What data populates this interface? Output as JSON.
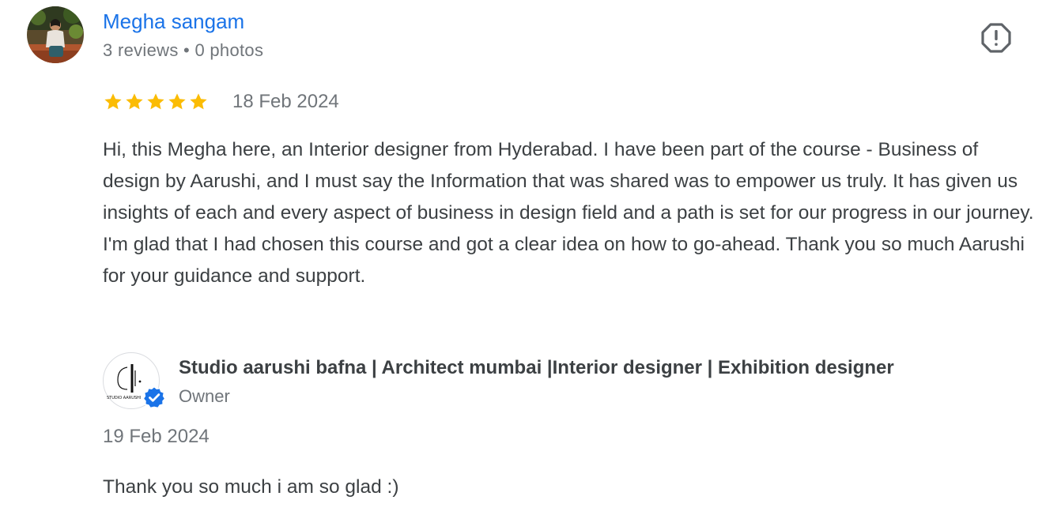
{
  "reviewer": {
    "name": "Megha sangam",
    "meta": "3 reviews • 0 photos",
    "avatar_icon": "user-photo-avatar"
  },
  "review": {
    "rating": 5,
    "max_rating": 5,
    "date": "18 Feb 2024",
    "text": "Hi, this Megha here, an Interior designer from Hyderabad. I have been part of the course - Business of design by Aarushi, and I must say the Information that was shared was to empower us truly. It has given us insights of each and every aspect of business in design field and a path is set for our progress in our journey. I'm glad that I had chosen this course and got a clear idea on how to go-ahead. Thank you so much Aarushi for your guidance and support."
  },
  "actions": {
    "flag_icon": "report-flag-icon"
  },
  "owner_reply": {
    "name": "Studio aarushi bafna | Architect mumbai |Interior designer | Exhibition designer",
    "role": "Owner",
    "logo_text": "STUDIO AARUSHI",
    "date": "19 Feb 2024",
    "text": "Thank you so much i am so glad :)"
  },
  "colors": {
    "name_link": "#1a73e8",
    "star": "#fbbc04",
    "verified": "#1a73e8",
    "secondary_text": "#70757a",
    "body_text": "#3c4043"
  }
}
